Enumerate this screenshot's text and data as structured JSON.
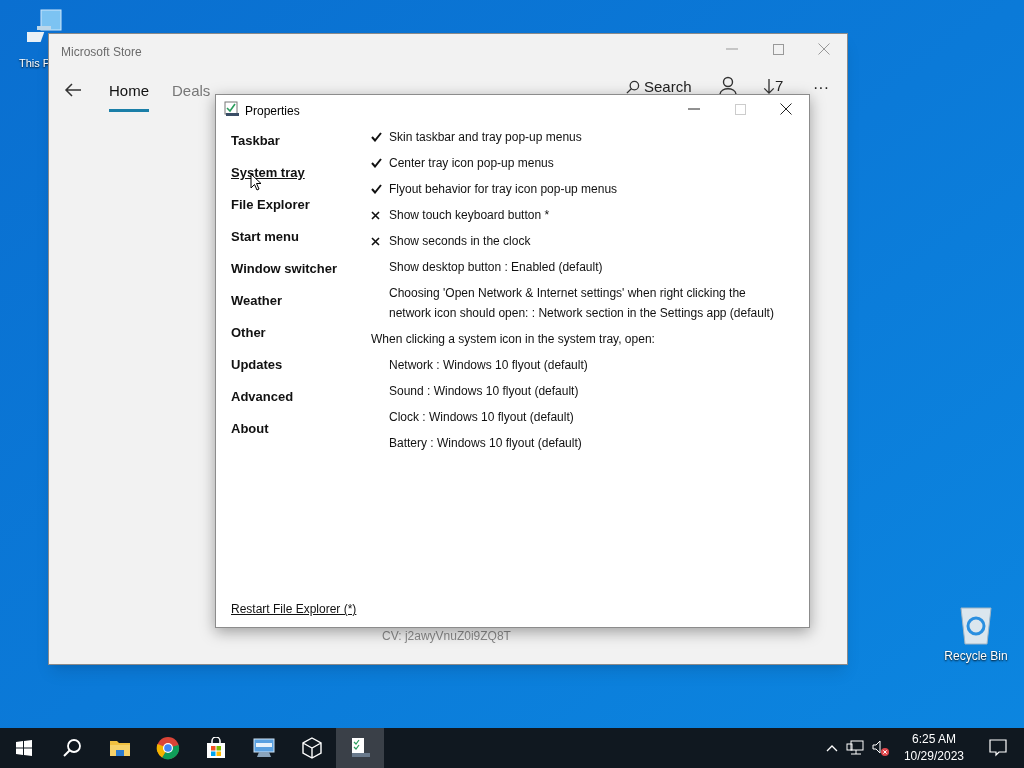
{
  "desktop_icons": [
    {
      "label": "This P",
      "kind": "computer"
    },
    {
      "label": "Recycle Bin",
      "kind": "bin"
    }
  ],
  "store": {
    "title": "Microsoft Store",
    "tabs": [
      {
        "label": "Home",
        "selected": true
      },
      {
        "label": "Deals",
        "selected": false
      }
    ],
    "search": "Search",
    "downloads": "7",
    "more": "···",
    "footer": "CV: j2awyVnuZ0i9ZQ8T"
  },
  "properties": {
    "title": "Properties",
    "nav": [
      {
        "label": "Taskbar",
        "selected": false
      },
      {
        "label": "System tray",
        "selected": true
      },
      {
        "label": "File Explorer",
        "selected": false
      },
      {
        "label": "Start menu",
        "selected": false
      },
      {
        "label": "Window switcher",
        "selected": false
      },
      {
        "label": "Weather",
        "selected": false
      },
      {
        "label": "Other",
        "selected": false
      },
      {
        "label": "Updates",
        "selected": false
      },
      {
        "label": "Advanced",
        "selected": false
      },
      {
        "label": "About",
        "selected": false
      }
    ],
    "options": [
      {
        "kind": "check",
        "label": "Skin taskbar and tray pop-up menus",
        "checked": true
      },
      {
        "kind": "check",
        "label": "Center tray icon pop-up menus",
        "checked": true
      },
      {
        "kind": "check",
        "label": "Flyout behavior for tray icon pop-up menus",
        "checked": true
      },
      {
        "kind": "check",
        "label": "Show touch keyboard button *",
        "checked": false
      },
      {
        "kind": "check",
        "label": "Show seconds in the clock",
        "checked": false
      },
      {
        "kind": "choice",
        "label": "Show desktop button : Enabled (default)"
      },
      {
        "kind": "choice",
        "label": "Choosing 'Open Network & Internet settings' when right clicking the network icon should open: : Network section in the Settings app (default)"
      },
      {
        "kind": "heading",
        "label": "When clicking a system icon in the system tray, open:"
      },
      {
        "kind": "choice",
        "label": "Network : Windows 10 flyout (default)"
      },
      {
        "kind": "choice",
        "label": "Sound : Windows 10 flyout (default)"
      },
      {
        "kind": "choice",
        "label": "Clock : Windows 10 flyout (default)"
      },
      {
        "kind": "choice",
        "label": "Battery : Windows 10 flyout (default)"
      }
    ],
    "restart_link": "Restart File Explorer (*)"
  },
  "taskbar": {
    "apps": [
      {
        "kind": "explorer",
        "selected": false
      },
      {
        "kind": "chrome",
        "selected": false
      },
      {
        "kind": "store",
        "selected": false
      },
      {
        "kind": "remote",
        "selected": false
      },
      {
        "kind": "cube",
        "selected": false
      },
      {
        "kind": "properties",
        "selected": true
      }
    ],
    "time": "6:25 AM",
    "date": "10/29/2023"
  }
}
